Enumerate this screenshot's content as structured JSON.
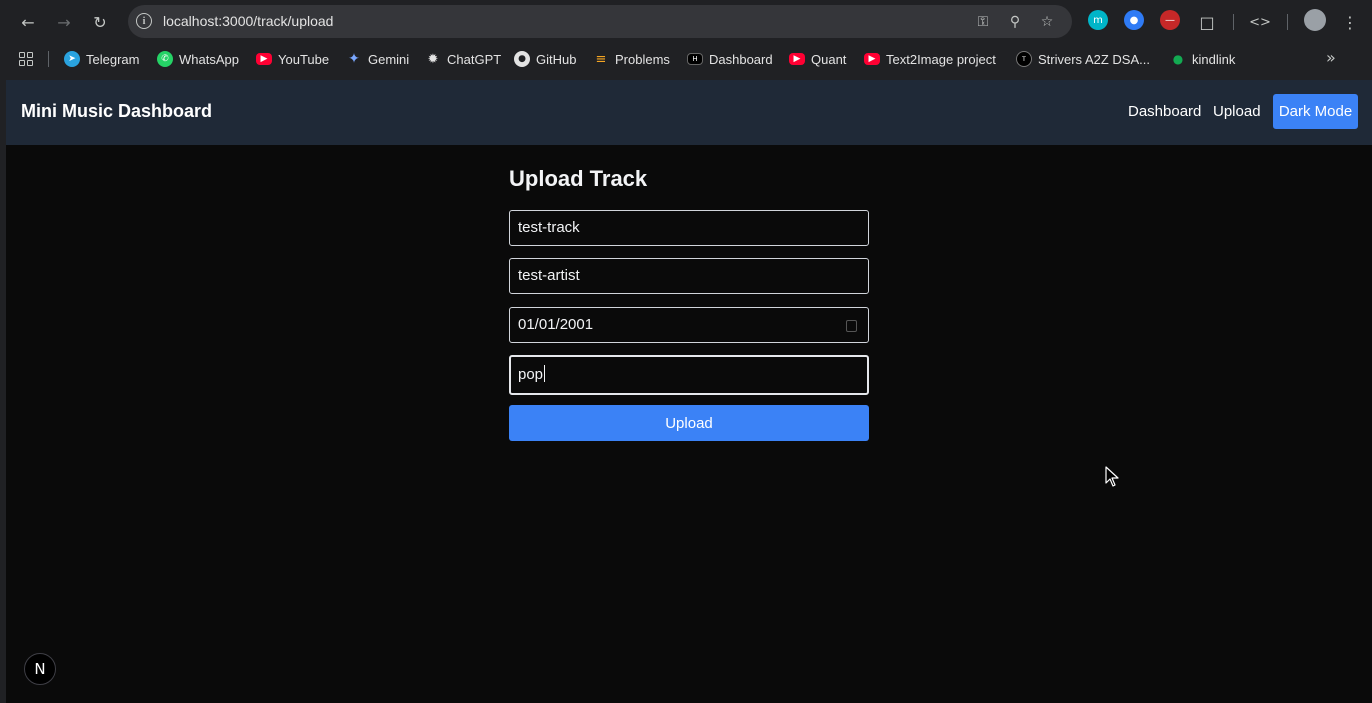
{
  "browser": {
    "url": "localhost:3000/track/upload",
    "bookmarks": [
      {
        "label": "Telegram",
        "color": "#2aa3df"
      },
      {
        "label": "WhatsApp",
        "color": "#25d366"
      },
      {
        "label": "YouTube",
        "color": "#ff0033"
      },
      {
        "label": "Gemini",
        "color": "#7aa7ff"
      },
      {
        "label": "ChatGPT",
        "color": "#e3e3e3"
      },
      {
        "label": "GitHub",
        "color": "#e3e3e3"
      },
      {
        "label": "Problems",
        "color": "#f5a623"
      },
      {
        "label": "Dashboard",
        "color": "#111111"
      },
      {
        "label": "Quant",
        "color": "#ff0033"
      },
      {
        "label": "Text2Image project",
        "color": "#ff0033"
      },
      {
        "label": "Strivers A2Z DSA...",
        "color": "#111111"
      },
      {
        "label": "kindlink",
        "color": "#13aa52"
      }
    ]
  },
  "app": {
    "brand": "Mini Music Dashboard",
    "nav": {
      "dashboard": "Dashboard",
      "upload": "Upload",
      "dark_mode": "Dark Mode"
    },
    "accent_color": "#3b82f6",
    "form": {
      "title": "Upload Track",
      "track_name": "test-track",
      "artist": "test-artist",
      "release_date": "01/01/2001",
      "genre": "pop",
      "submit_label": "Upload"
    },
    "dev_badge": "N"
  }
}
